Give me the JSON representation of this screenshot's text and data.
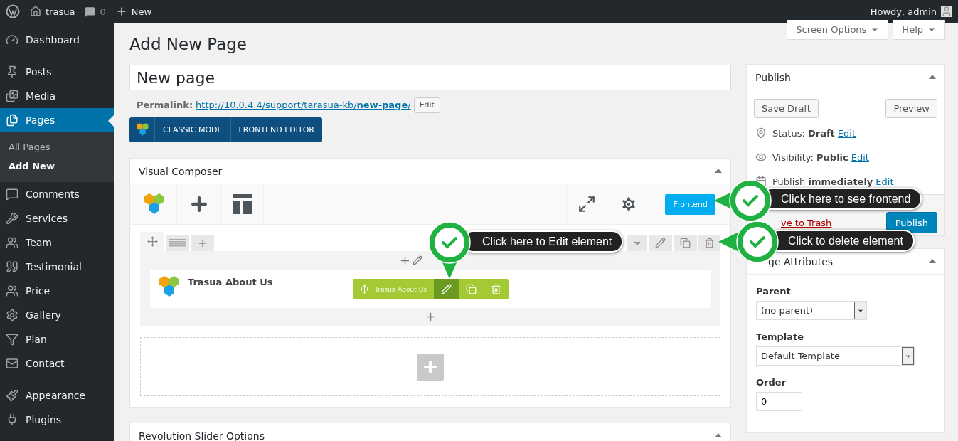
{
  "admin_bar": {
    "site": "trasua",
    "comments": "0",
    "new": "New",
    "greeting": "Howdy, admin"
  },
  "sidebar": {
    "groups": [
      {
        "items": [
          {
            "label": "Dashboard",
            "selected": false
          }
        ]
      },
      {
        "items": [
          {
            "label": "Posts",
            "selected": false
          },
          {
            "label": "Media",
            "selected": false
          },
          {
            "label": "Pages",
            "selected": true,
            "children": [
              {
                "label": "All Pages",
                "selected": false
              },
              {
                "label": "Add New",
                "selected": true
              }
            ]
          },
          {
            "label": "Comments",
            "selected": false
          },
          {
            "label": "Services",
            "selected": false
          },
          {
            "label": "Team",
            "selected": false
          },
          {
            "label": "Testimonial",
            "selected": false
          },
          {
            "label": "Price",
            "selected": false
          },
          {
            "label": "Gallery",
            "selected": false
          },
          {
            "label": "Plan",
            "selected": false
          },
          {
            "label": "Contact",
            "selected": false
          }
        ]
      },
      {
        "items": [
          {
            "label": "Appearance",
            "selected": false
          },
          {
            "label": "Plugins",
            "selected": false
          }
        ]
      }
    ]
  },
  "screen_tabs": [
    {
      "label": "Screen Options"
    },
    {
      "label": "Help"
    }
  ],
  "page_title": "Add New Page",
  "title_field": {
    "value": "New page"
  },
  "permalink": {
    "label": "Permalink:",
    "url": "http://10.0.4.4/support/tarasua-kb/**new-page**/",
    "edit_button": "Edit"
  },
  "mode_buttons": [
    "CLASSIC MODE",
    "FRONTEND EDITOR"
  ],
  "composer": {
    "title": "Visual Composer",
    "frontend_button": "Frontend",
    "element": {
      "name": "Trasua About Us",
      "toolbar_label": "Trasua About Us"
    }
  },
  "revolution": {
    "title": "Revolution Slider Options"
  },
  "publish": {
    "title": "Publish",
    "save_draft": "Save Draft",
    "preview": "Preview",
    "meta": [
      {
        "label": "Status:",
        "value": "Draft",
        "link": "Edit"
      },
      {
        "label": "Visibility:",
        "value": "Public",
        "link": "Edit"
      },
      {
        "label": "Publish",
        "value": "immediately",
        "link": "Edit"
      }
    ],
    "trash": "ve to Trash",
    "publish_button": "Publish"
  },
  "page_attributes": {
    "title": "ge Attributes",
    "parent_label": "Parent",
    "parent": "(no parent)",
    "template_label": "Template",
    "template": "Default Template",
    "order_label": "Order",
    "order": "0"
  },
  "callouts": [
    {
      "text": "Click here to Edit element",
      "kind": "down"
    },
    {
      "text": "Click here to see frontend",
      "kind": "left"
    },
    {
      "text": "Click to delete element",
      "kind": "left"
    }
  ]
}
